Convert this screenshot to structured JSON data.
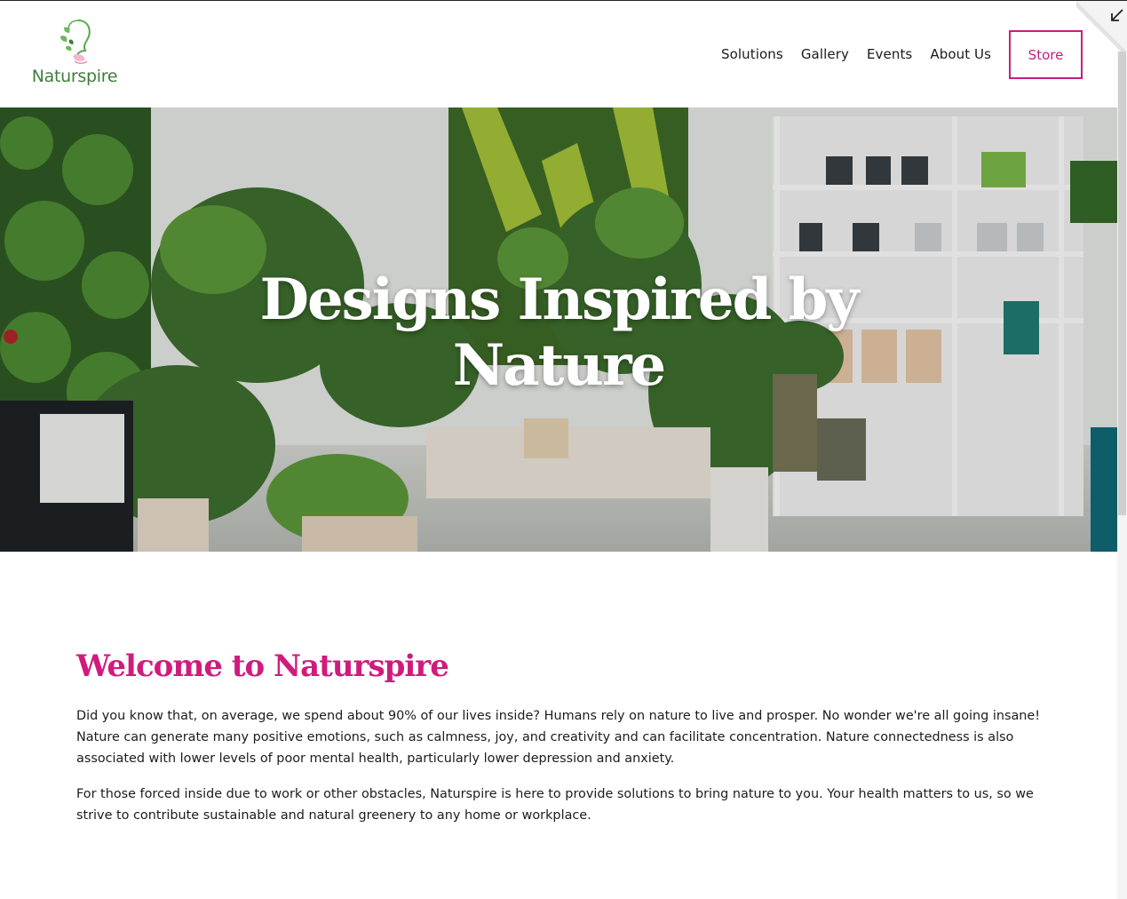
{
  "brand": {
    "name": "Naturspire",
    "logo_icon": "woman-silhouette-leaf-logo",
    "primary_color": "#c41e7f",
    "logo_color": "#3f7d3a"
  },
  "nav": {
    "items": [
      {
        "label": "Solutions"
      },
      {
        "label": "Gallery"
      },
      {
        "label": "Events"
      },
      {
        "label": "About Us"
      }
    ],
    "store_label": "Store"
  },
  "hero": {
    "title": "Designs Inspired by Nature",
    "image_icon": "plant-showroom-photo"
  },
  "welcome": {
    "heading": "Welcome to Naturspire",
    "paragraphs": [
      "Did you know that, on average, we spend about 90% of our lives inside? Humans rely on nature to live and prosper. No wonder we're all going insane! Nature can generate many positive emotions, such as calmness, joy, and creativity and can facilitate concentration. Nature connectedness is also associated with lower levels of poor mental health, particularly lower depression and anxiety.",
      "For those forced inside due to work or other obstacles, Naturspire is here to provide solutions to bring nature to you. Your health matters to us, so we strive to contribute sustainable and natural greenery to any home or workplace."
    ]
  },
  "corner": {
    "icon": "collapse-arrow-icon"
  }
}
